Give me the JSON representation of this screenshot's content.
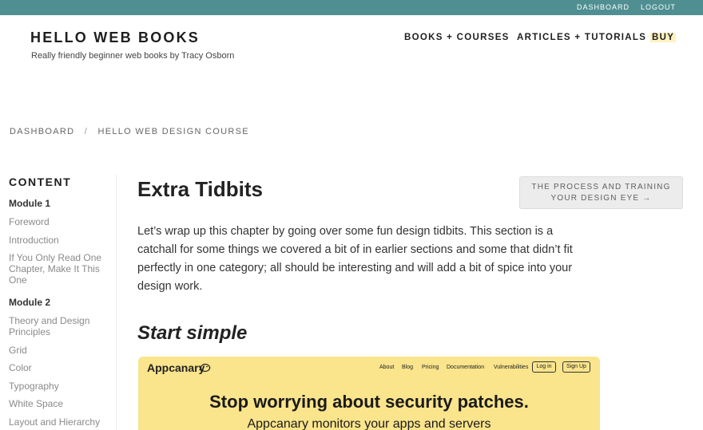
{
  "topbar": {
    "dashboard": "DASHBOARD",
    "logout": "LOGOUT"
  },
  "header": {
    "brand": "HELLO WEB BOOKS",
    "tagline": "Really friendly beginner web books by Tracy Osborn",
    "nav": {
      "books": "BOOKS + COURSES",
      "articles": "ARTICLES + TUTORIALS",
      "buy": "BUY"
    }
  },
  "breadcrumb": {
    "home": "DASHBOARD",
    "separator": "/",
    "current": "HELLO WEB DESIGN COURSE"
  },
  "sidebar": {
    "title": "CONTENT",
    "module1": {
      "label": "Module 1",
      "items": [
        "Foreword",
        "Introduction",
        "If You Only Read One Chapter, Make It This One"
      ]
    },
    "module2": {
      "label": "Module 2",
      "items": [
        "Theory and Design Principles",
        "Grid",
        "Color",
        "Typography",
        "White Space",
        "Layout and Hierarchy"
      ]
    }
  },
  "main": {
    "title": "Extra Tidbits",
    "next_button": {
      "line1": "THE PROCESS AND TRAINING",
      "line2": "YOUR DESIGN EYE →"
    },
    "intro": "Let’s wrap up this chapter by going over some fun design tidbits. This section is a catchall for some things we covered a bit of in earlier sections and some that didn’t fit perfectly in one category; all should be interesting and will add a bit of spice into your design work.",
    "section_heading": "Start simple"
  },
  "screenshot": {
    "logo": "Appcanary",
    "nav": [
      "About",
      "Blog",
      "Pricing",
      "Documentation",
      "Vulnerabilities"
    ],
    "login": "Log in",
    "signup": "Sign Up",
    "headline": "Stop worrying about security patches.",
    "subline": "Appcanary monitors your apps and servers"
  },
  "colors": {
    "topbar": "#4f8f92",
    "buy_highlight": "#fdf1bf",
    "screenshot_bg": "#fae48c"
  }
}
